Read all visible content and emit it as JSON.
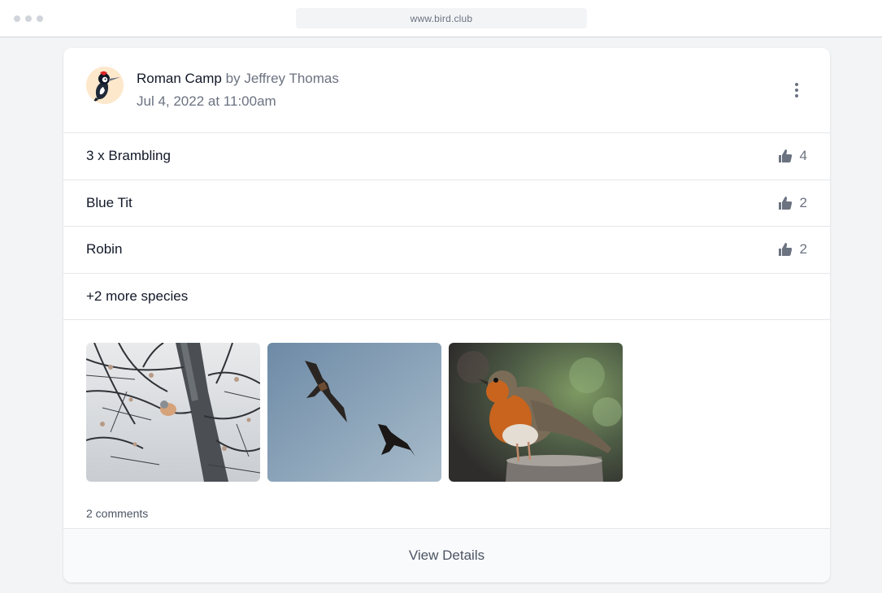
{
  "browser": {
    "url": "www.bird.club"
  },
  "post": {
    "location": "Roman Camp",
    "by_label": "by",
    "author": "Jeffrey Thomas",
    "date": "Jul 4, 2022 at 11:00am",
    "avatar_icon": "woodpecker-avatar",
    "menu_icon": "vertical-dots-icon"
  },
  "species": [
    {
      "name": "3 x Brambling",
      "likes": "4"
    },
    {
      "name": "Blue Tit",
      "likes": "2"
    },
    {
      "name": "Robin",
      "likes": "2"
    }
  ],
  "more_species": "+2 more species",
  "photos": [
    {
      "subject": "brambling-in-tree"
    },
    {
      "subject": "two-birds-of-prey-in-flight"
    },
    {
      "subject": "robin-on-post"
    }
  ],
  "comments_label": "2 comments",
  "footer": {
    "view_details_label": "View Details"
  },
  "colors": {
    "background": "#f3f4f6",
    "card": "#ffffff",
    "text_primary": "#111827",
    "text_secondary": "#6b7280",
    "border": "#e5e7eb",
    "footer_bg": "#f9fafb",
    "avatar_bg": "#fde8cc"
  }
}
